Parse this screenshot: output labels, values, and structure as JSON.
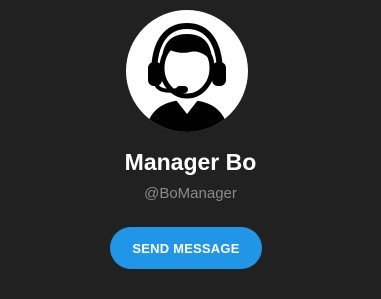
{
  "profile": {
    "avatar_icon": "support-agent-headset-icon",
    "display_name": "Manager Bo",
    "username": "@BoManager"
  },
  "actions": {
    "send_message_label": "SEND MESSAGE"
  },
  "colors": {
    "background": "#212121",
    "accent": "#2196e6",
    "name_text": "#ffffff",
    "username_text": "#8a8a8a"
  }
}
